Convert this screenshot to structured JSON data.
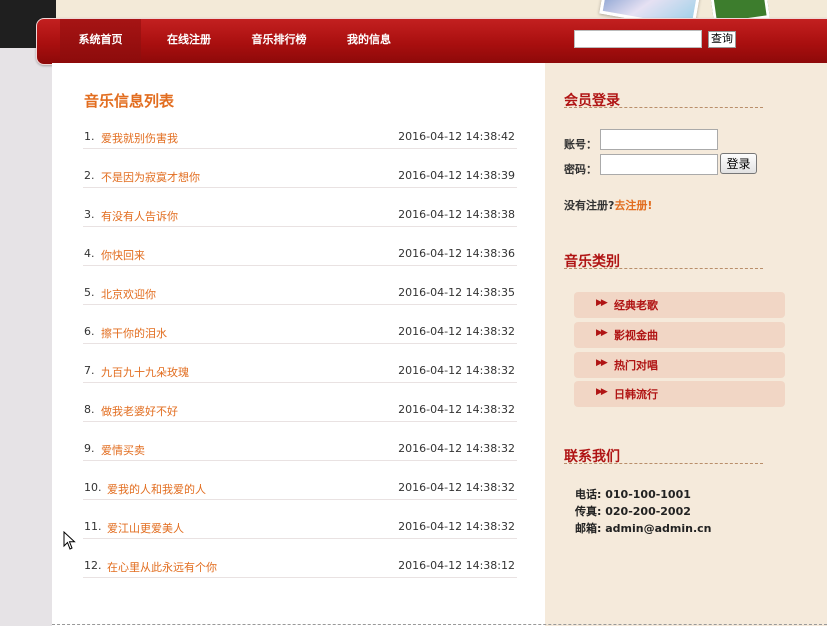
{
  "nav": {
    "items": [
      "系统首页",
      "在线注册",
      "音乐排行榜",
      "我的信息"
    ],
    "search_value": "",
    "search_button": "查询"
  },
  "music_list": {
    "title": "音乐信息列表",
    "items": [
      {
        "index": "1.",
        "title": "爱我就别伤害我",
        "date": "2016-04-12 14:38:42"
      },
      {
        "index": "2.",
        "title": "不是因为寂寞才想你",
        "date": "2016-04-12 14:38:39"
      },
      {
        "index": "3.",
        "title": "有没有人告诉你",
        "date": "2016-04-12 14:38:38"
      },
      {
        "index": "4.",
        "title": "你快回来",
        "date": "2016-04-12 14:38:36"
      },
      {
        "index": "5.",
        "title": "北京欢迎你",
        "date": "2016-04-12 14:38:35"
      },
      {
        "index": "6.",
        "title": "擦干你的泪水",
        "date": "2016-04-12 14:38:32"
      },
      {
        "index": "7.",
        "title": "九百九十九朵玫瑰",
        "date": "2016-04-12 14:38:32"
      },
      {
        "index": "8.",
        "title": "做我老婆好不好",
        "date": "2016-04-12 14:38:32"
      },
      {
        "index": "9.",
        "title": "爱情买卖",
        "date": "2016-04-12 14:38:32"
      },
      {
        "index": "10.",
        "title": "爱我的人和我爱的人",
        "date": "2016-04-12 14:38:32"
      },
      {
        "index": "11.",
        "title": "爱江山更爱美人",
        "date": "2016-04-12 14:38:32"
      },
      {
        "index": "12.",
        "title": "在心里从此永远有个你",
        "date": "2016-04-12 14:38:12"
      }
    ]
  },
  "login": {
    "title": "会员登录",
    "account_label": "账号：",
    "password_label": "密码：",
    "account_value": "",
    "password_value": "",
    "button": "登录",
    "register_prompt": "没有注册?",
    "register_link": "去注册!"
  },
  "categories": {
    "title": "音乐类别",
    "items": [
      "经典老歌",
      "影视金曲",
      "热门对唱",
      "日韩流行"
    ]
  },
  "contact": {
    "title": "联系我们",
    "phone": "电话: 010-100-1001",
    "fax": "传真: 020-200-2002",
    "email": "邮箱: admin@admin.cn"
  },
  "colors": {
    "nav_red": "#a90f0f",
    "title_orange": "#e26d1f",
    "sidebar_title_red": "#b01414",
    "sidebar_bg": "#f5eadb"
  }
}
